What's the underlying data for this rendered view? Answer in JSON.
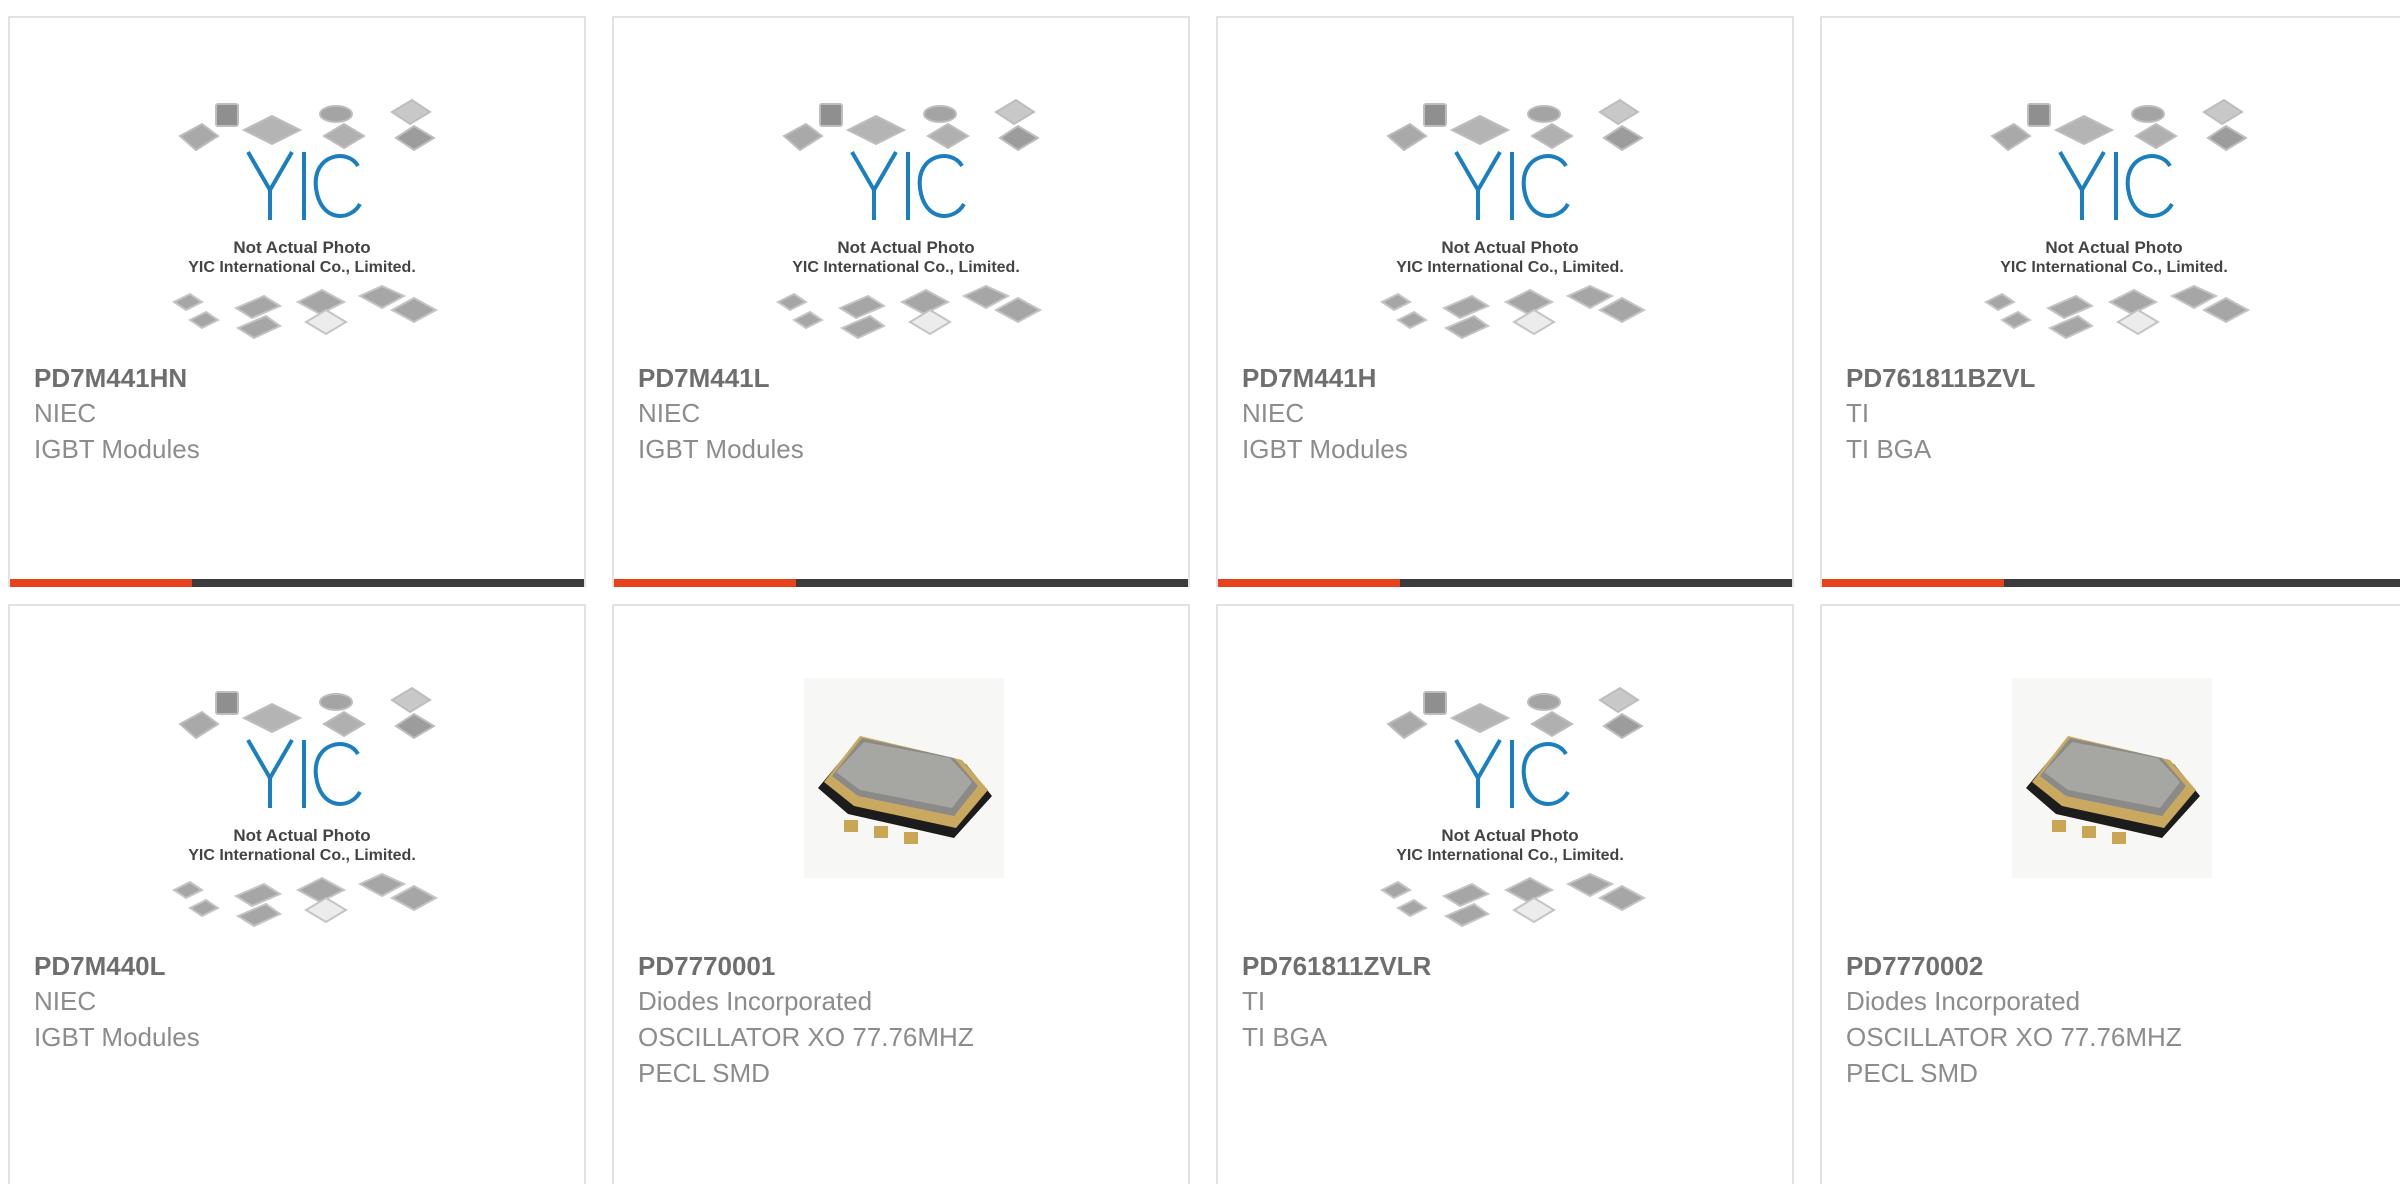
{
  "placeholder": {
    "line1": "Not Actual Photo",
    "line2": "YIC International Co., Limited.",
    "logo_text": "YIC"
  },
  "colors": {
    "accent": "#e8421d",
    "bar": "#3b3b3b",
    "logo_blue": "#1a7fc1",
    "text_dark": "#6e6e6e",
    "text_light": "#8c8c8c"
  },
  "products": [
    {
      "part": "PD7M441HN",
      "manufacturer": "NIEC",
      "desc1": "IGBT Modules",
      "desc2": "",
      "image": "placeholder"
    },
    {
      "part": "PD7M441L",
      "manufacturer": "NIEC",
      "desc1": "IGBT Modules",
      "desc2": "",
      "image": "placeholder"
    },
    {
      "part": "PD7M441H",
      "manufacturer": "NIEC",
      "desc1": "IGBT Modules",
      "desc2": "",
      "image": "placeholder"
    },
    {
      "part": "PD761811BZVL",
      "manufacturer": "TI",
      "desc1": "TI BGA",
      "desc2": "",
      "image": "placeholder"
    },
    {
      "part": "PD7M440L",
      "manufacturer": "NIEC",
      "desc1": "IGBT Modules",
      "desc2": "",
      "image": "placeholder"
    },
    {
      "part": "PD7770001",
      "manufacturer": "Diodes Incorporated",
      "desc1": "OSCILLATOR XO 77.76MHZ",
      "desc2": "PECL SMD",
      "image": "oscillator"
    },
    {
      "part": "PD761811ZVLR",
      "manufacturer": "TI",
      "desc1": "TI BGA",
      "desc2": "",
      "image": "placeholder"
    },
    {
      "part": "PD7770002",
      "manufacturer": "Diodes Incorporated",
      "desc1": "OSCILLATOR XO 77.76MHZ",
      "desc2": "PECL SMD",
      "image": "oscillator"
    }
  ]
}
